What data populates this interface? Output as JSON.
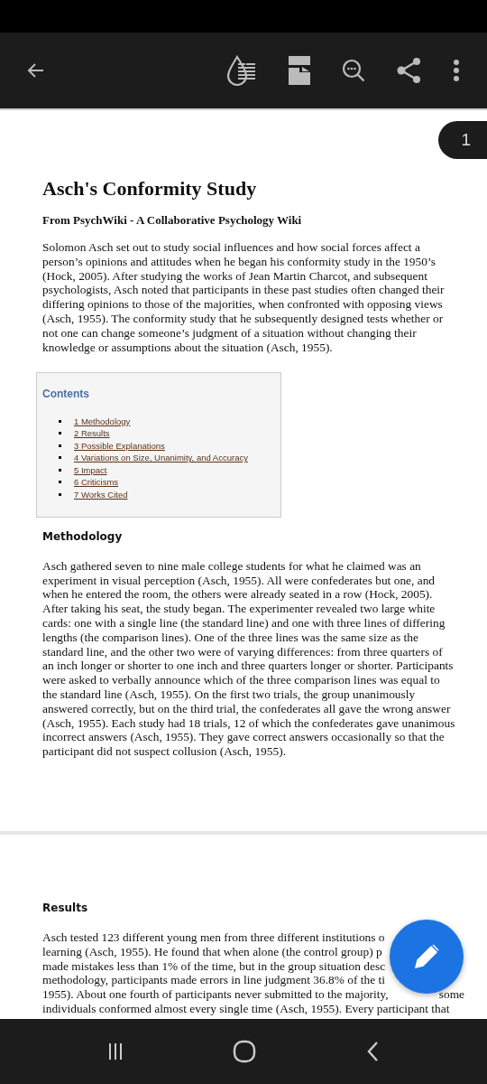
{
  "page_number": "1",
  "document": {
    "title": "Asch's Conformity Study",
    "subtitle": "From PsychWiki - A Collaborative Psychology Wiki",
    "intro": "Solomon Asch set out to study social influences and how social forces affect a person’s opinions and attitudes when he began his conformity study in the 1950’s (Hock, 2005). After studying the works of Jean Martin Charcot, and subsequent psychologists, Asch noted that participants in these past studies often changed their differing opinions to those of the majorities, when confronted with opposing views (Asch, 1955). The conformity study that he subsequently designed tests whether or not one can change someone’s judgment of a situation without changing their knowledge or assumptions about the situation (Asch, 1955).",
    "contents": {
      "heading": "Contents",
      "items": [
        "1 Methodology",
        "2 Results",
        "3 Possible Explanations",
        "4 Variations on Size, Unanimity, and Accuracy",
        "5 Impact",
        "6 Criticisms",
        "7 Works Cited"
      ]
    },
    "methodology": {
      "heading": "Methodology",
      "text": "Asch gathered seven to nine male college students for what he claimed was an experiment in visual perception (Asch, 1955). All were confederates but one, and when he entered the room, the others were already seated in a row (Hock, 2005). After taking his seat, the study began. The experimenter revealed two large white cards: one with a single line (the standard line) and one with three lines of differing lengths (the comparison lines). One of the three lines was the same size as the standard line, and the other two were of varying differences: from three quarters of an inch longer or shorter to one inch and three quarters longer or shorter. Participants were asked to verbally announce which of the three comparison lines was equal to the standard line (Asch, 1955). On the first two trials, the group unanimously answered correctly, but on the third trial, the confederates all gave the wrong answer (Asch, 1955). Each study had 18 trials, 12 of which the confederates gave unanimous incorrect answers (Asch, 1955). They gave correct answers occasionally so that the participant did not suspect collusion (Asch, 1955)."
    },
    "results": {
      "heading": "Results",
      "lines": [
        {
          "text": "Asch tested 123 different young men from three different institutions o"
        },
        {
          "text": "learning (Asch, 1955). He found that when alone (the control group) p"
        },
        {
          "text": "made mistakes less than 1% of the time, but in the group situation desc"
        },
        {
          "text": "methodology, participants made errors in line judgment 36.8% of the ti"
        },
        {
          "text": "1955). About one fourth of participants never submitted to the majority,",
          "tail": "some"
        },
        {
          "text": "individuals conformed almost every single time (Asch, 1955). Every participant that"
        }
      ]
    }
  }
}
